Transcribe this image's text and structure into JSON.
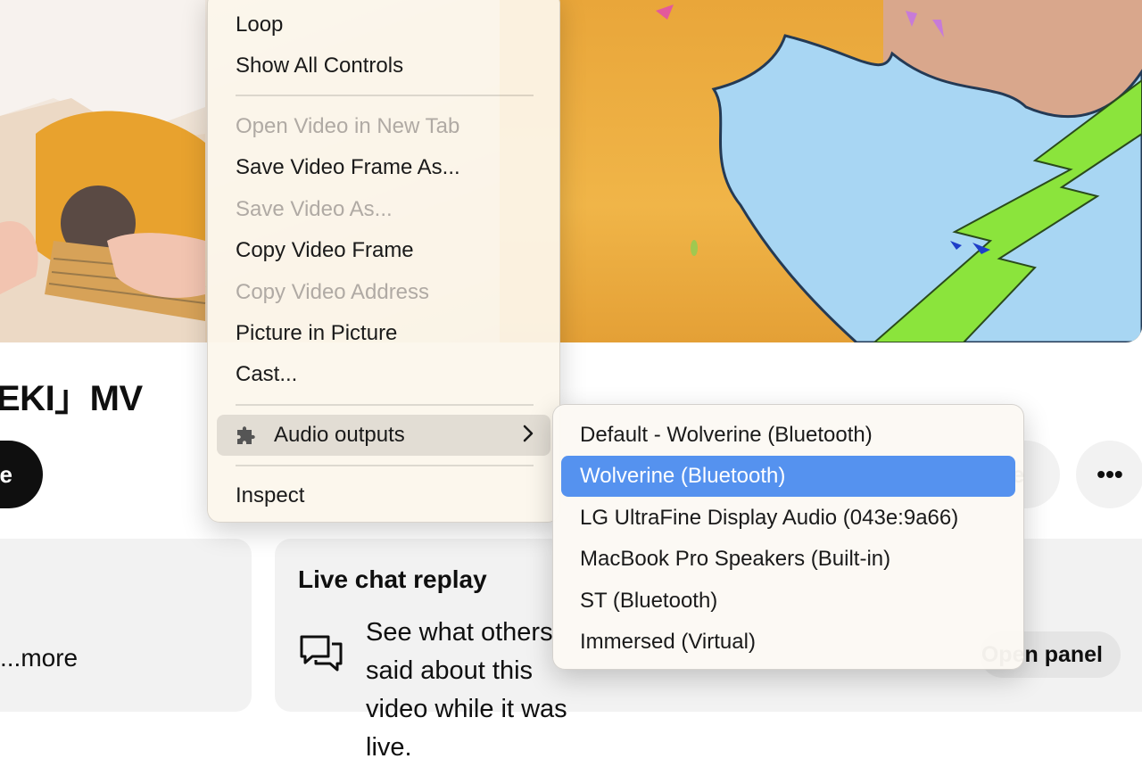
{
  "video": {
    "title": "EKI」MV"
  },
  "actions": {
    "subscribe_label": "e",
    "share_label": "e",
    "more_label": "•••"
  },
  "description": {
    "more_label": "...more"
  },
  "live_chat": {
    "title": "Live chat replay",
    "text": "See what others said about this video while it was live.",
    "open_panel_label": "Open panel"
  },
  "context_menu": {
    "items": [
      {
        "label": "Loop",
        "enabled": true
      },
      {
        "label": "Show All Controls",
        "enabled": true
      },
      {
        "label": "Open Video in New Tab",
        "enabled": false
      },
      {
        "label": "Save Video Frame As...",
        "enabled": true
      },
      {
        "label": "Save Video As...",
        "enabled": false
      },
      {
        "label": "Copy Video Frame",
        "enabled": true
      },
      {
        "label": "Copy Video Address",
        "enabled": false
      },
      {
        "label": "Picture in Picture",
        "enabled": true
      },
      {
        "label": "Cast...",
        "enabled": true
      },
      {
        "label": "Audio outputs",
        "enabled": true,
        "icon": "puzzle-icon",
        "has_submenu": true
      },
      {
        "label": "Inspect",
        "enabled": true
      }
    ]
  },
  "audio_outputs": {
    "items": [
      {
        "label": "Default - Wolverine (Bluetooth)",
        "selected": false
      },
      {
        "label": "Wolverine (Bluetooth)",
        "selected": true
      },
      {
        "label": "LG UltraFine Display Audio (043e:9a66)",
        "selected": false
      },
      {
        "label": "MacBook Pro Speakers (Built-in)",
        "selected": false
      },
      {
        "label": "ST (Bluetooth)",
        "selected": false
      },
      {
        "label": "Immersed (Virtual)",
        "selected": false
      }
    ],
    "selected_color": "#5592ef"
  }
}
